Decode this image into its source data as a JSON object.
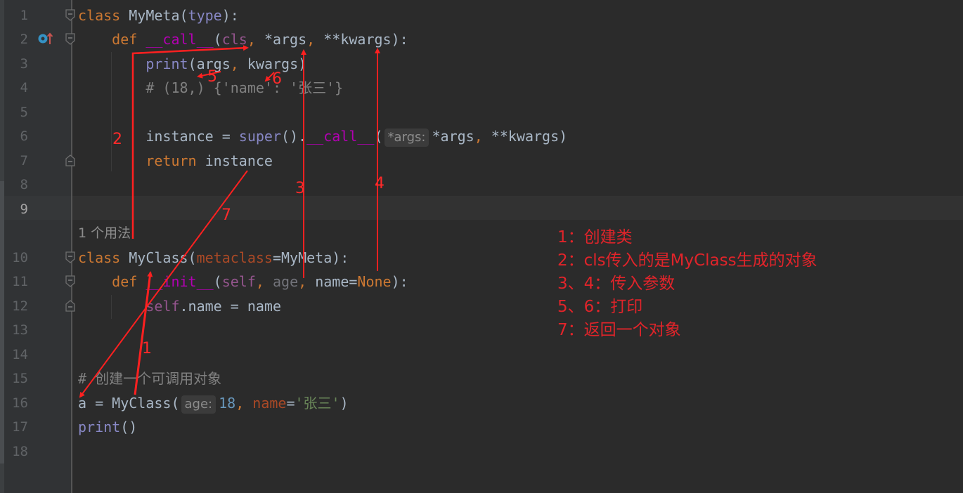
{
  "editor": {
    "current_line": 9,
    "lines": [
      {
        "n": 1,
        "tokens": [
          [
            "kw",
            "class "
          ],
          [
            "fn",
            "MyMeta"
          ],
          [
            "plain",
            "("
          ],
          [
            "builtin",
            "type"
          ],
          [
            "plain",
            "):"
          ]
        ]
      },
      {
        "n": 2,
        "tokens": [
          [
            "plain",
            "    "
          ],
          [
            "kw",
            "def "
          ],
          [
            "magic",
            "__call__"
          ],
          [
            "plain",
            "("
          ],
          [
            "self",
            "cls"
          ],
          [
            "kw",
            ", "
          ],
          [
            "plain",
            "*args"
          ],
          [
            "kw",
            ", "
          ],
          [
            "plain",
            "**kwargs):"
          ]
        ]
      },
      {
        "n": 3,
        "tokens": [
          [
            "plain",
            "        "
          ],
          [
            "builtin",
            "print"
          ],
          [
            "plain",
            "(args"
          ],
          [
            "kw",
            ", "
          ],
          [
            "plain",
            "kwargs)"
          ]
        ]
      },
      {
        "n": 4,
        "tokens": [
          [
            "plain",
            "        "
          ],
          [
            "comment",
            "# (18,) {'name': '张三'}"
          ]
        ]
      },
      {
        "n": 5,
        "tokens": []
      },
      {
        "n": 6,
        "tokens": [
          [
            "plain",
            "        instance = "
          ],
          [
            "builtin",
            "super"
          ],
          [
            "plain",
            "()."
          ],
          [
            "magic",
            "__call__"
          ],
          [
            "plain",
            "("
          ],
          [
            "hint",
            "*args:"
          ],
          [
            "plain",
            "*args"
          ],
          [
            "kw",
            ", "
          ],
          [
            "plain",
            "**kwargs)"
          ]
        ]
      },
      {
        "n": 7,
        "tokens": [
          [
            "plain",
            "        "
          ],
          [
            "kw",
            "return "
          ],
          [
            "plain",
            "instance"
          ]
        ]
      },
      {
        "n": 8,
        "tokens": []
      },
      {
        "n": 9,
        "tokens": []
      },
      {
        "n": 10,
        "tokens": [
          [
            "kw",
            "class "
          ],
          [
            "fn",
            "MyClass"
          ],
          [
            "plain",
            "("
          ],
          [
            "kwarg",
            "metaclass"
          ],
          [
            "plain",
            "=MyMeta):"
          ]
        ]
      },
      {
        "n": 11,
        "tokens": [
          [
            "plain",
            "    "
          ],
          [
            "kw",
            "def "
          ],
          [
            "magic",
            "__init__"
          ],
          [
            "plain",
            "("
          ],
          [
            "self",
            "self"
          ],
          [
            "kw",
            ", "
          ],
          [
            "unused",
            "age"
          ],
          [
            "kw",
            ", "
          ],
          [
            "plain",
            "name="
          ],
          [
            "kw",
            "None"
          ],
          [
            "plain",
            "):"
          ]
        ]
      },
      {
        "n": 12,
        "tokens": [
          [
            "plain",
            "        "
          ],
          [
            "self",
            "self"
          ],
          [
            "plain",
            ".name = name"
          ]
        ]
      },
      {
        "n": 13,
        "tokens": []
      },
      {
        "n": 14,
        "tokens": []
      },
      {
        "n": 15,
        "tokens": [
          [
            "comment",
            "# 创建一个可调用对象"
          ]
        ]
      },
      {
        "n": 16,
        "tokens": [
          [
            "plain",
            "a = MyClass("
          ],
          [
            "hint",
            "age:"
          ],
          [
            "num",
            "18"
          ],
          [
            "kw",
            ", "
          ],
          [
            "kwarg",
            "name"
          ],
          [
            "plain",
            "="
          ],
          [
            "str",
            "'张三'"
          ],
          [
            "plain",
            ")"
          ]
        ]
      },
      {
        "n": 17,
        "tokens": [
          [
            "builtin",
            "print"
          ],
          [
            "plain",
            "()"
          ]
        ]
      },
      {
        "n": 18,
        "tokens": []
      }
    ],
    "usage_hint": "1 个用法"
  },
  "annotations": {
    "markers": [
      "1",
      "2",
      "3",
      "4",
      "5",
      "6",
      "7"
    ],
    "legend": [
      "1：创建类",
      "2：cls传入的是MyClass生成的对象",
      "3、4：传入参数",
      "5、6：打印",
      "7：返回一个对象"
    ],
    "color": "#ff2020"
  }
}
